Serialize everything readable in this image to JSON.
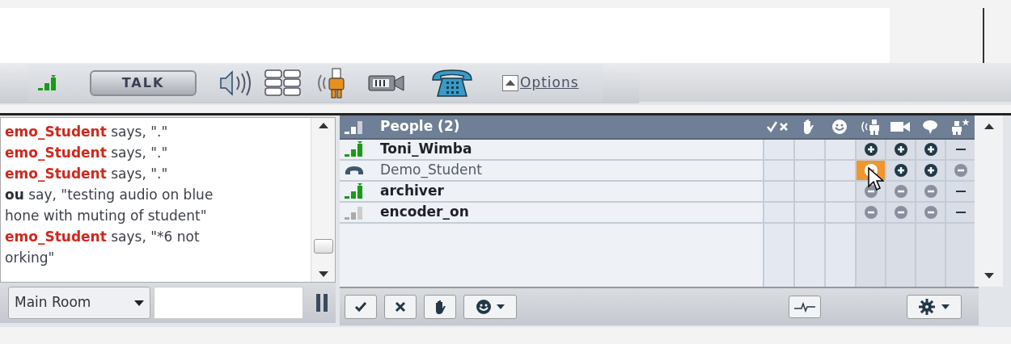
{
  "toolbar": {
    "talk_button": "TALK",
    "options_link": "Options"
  },
  "chat": {
    "messages": [
      {
        "kind": "other",
        "lines": [
          "**emo_Student** says, \".\""
        ]
      },
      {
        "kind": "other",
        "lines": [
          "**emo_Student** says, \".\""
        ]
      },
      {
        "kind": "other",
        "lines": [
          "**emo_Student** says, \".\""
        ]
      },
      {
        "kind": "self",
        "lines": [
          "**ou** say, \"testing audio on blue",
          "hone with muting of student\""
        ]
      },
      {
        "kind": "other",
        "lines": [
          "**emo_Student** says, \"*6 not",
          "orking\""
        ]
      }
    ],
    "room_select": "Main Room"
  },
  "people": {
    "title": "People (2)",
    "rows": [
      {
        "name": "Toni_Wimba",
        "kind": "active",
        "bold": true,
        "cells": [
          {
            "kind": "plus",
            "selected": false
          },
          {
            "kind": "plus",
            "selected": false
          },
          {
            "kind": "plus",
            "selected": false
          },
          {
            "kind": "dash",
            "selected": false
          }
        ]
      },
      {
        "name": "Demo_Student",
        "kind": "phone",
        "bold": false,
        "cells": [
          {
            "kind": "minus",
            "selected": true
          },
          {
            "kind": "plus",
            "selected": false
          },
          {
            "kind": "plus",
            "selected": false
          },
          {
            "kind": "minus",
            "selected": false
          }
        ]
      },
      {
        "name": "archiver",
        "kind": "active",
        "bold": true,
        "cells": [
          {
            "kind": "minus",
            "selected": false
          },
          {
            "kind": "minus",
            "selected": false
          },
          {
            "kind": "minus",
            "selected": false
          },
          {
            "kind": "dash",
            "selected": false
          }
        ]
      },
      {
        "name": "encoder_on",
        "kind": "idle",
        "bold": true,
        "cells": [
          {
            "kind": "minus",
            "selected": false
          },
          {
            "kind": "minus",
            "selected": false
          },
          {
            "kind": "minus",
            "selected": false
          },
          {
            "kind": "dash",
            "selected": false
          }
        ]
      }
    ]
  }
}
